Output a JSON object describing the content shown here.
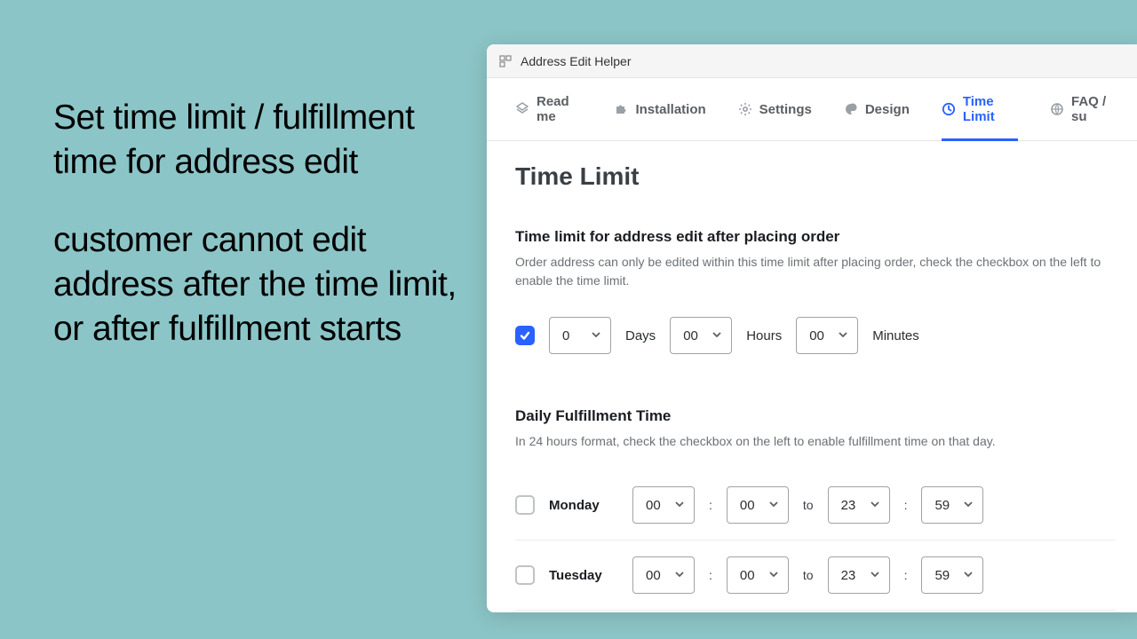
{
  "promo": {
    "p1": "Set time limit / fulfillment time for address edit",
    "p2": "customer cannot edit address after the time limit, or after fulfillment starts"
  },
  "titlebar": {
    "title": "Address Edit Helper"
  },
  "tabs": [
    {
      "label": "Read me"
    },
    {
      "label": "Installation"
    },
    {
      "label": "Settings"
    },
    {
      "label": "Design"
    },
    {
      "label": "Time Limit"
    },
    {
      "label": "FAQ / su"
    }
  ],
  "page_title": "Time Limit",
  "time_limit": {
    "title": "Time limit for address edit after placing order",
    "desc": "Order address can only be edited within this time limit after placing order, check the checkbox on the left to enable the time limit.",
    "enabled": true,
    "days": "0",
    "days_label": "Days",
    "hours": "00",
    "hours_label": "Hours",
    "minutes": "00",
    "minutes_label": "Minutes"
  },
  "fulfillment": {
    "title": "Daily Fulfillment Time",
    "desc": "In 24 hours format, check the checkbox on the left to enable fulfillment time on that day.",
    "to_label": "to",
    "colon": ":",
    "days": [
      {
        "name": "Monday",
        "enabled": false,
        "from_h": "00",
        "from_m": "00",
        "to_h": "23",
        "to_m": "59"
      },
      {
        "name": "Tuesday",
        "enabled": false,
        "from_h": "00",
        "from_m": "00",
        "to_h": "23",
        "to_m": "59"
      }
    ]
  }
}
